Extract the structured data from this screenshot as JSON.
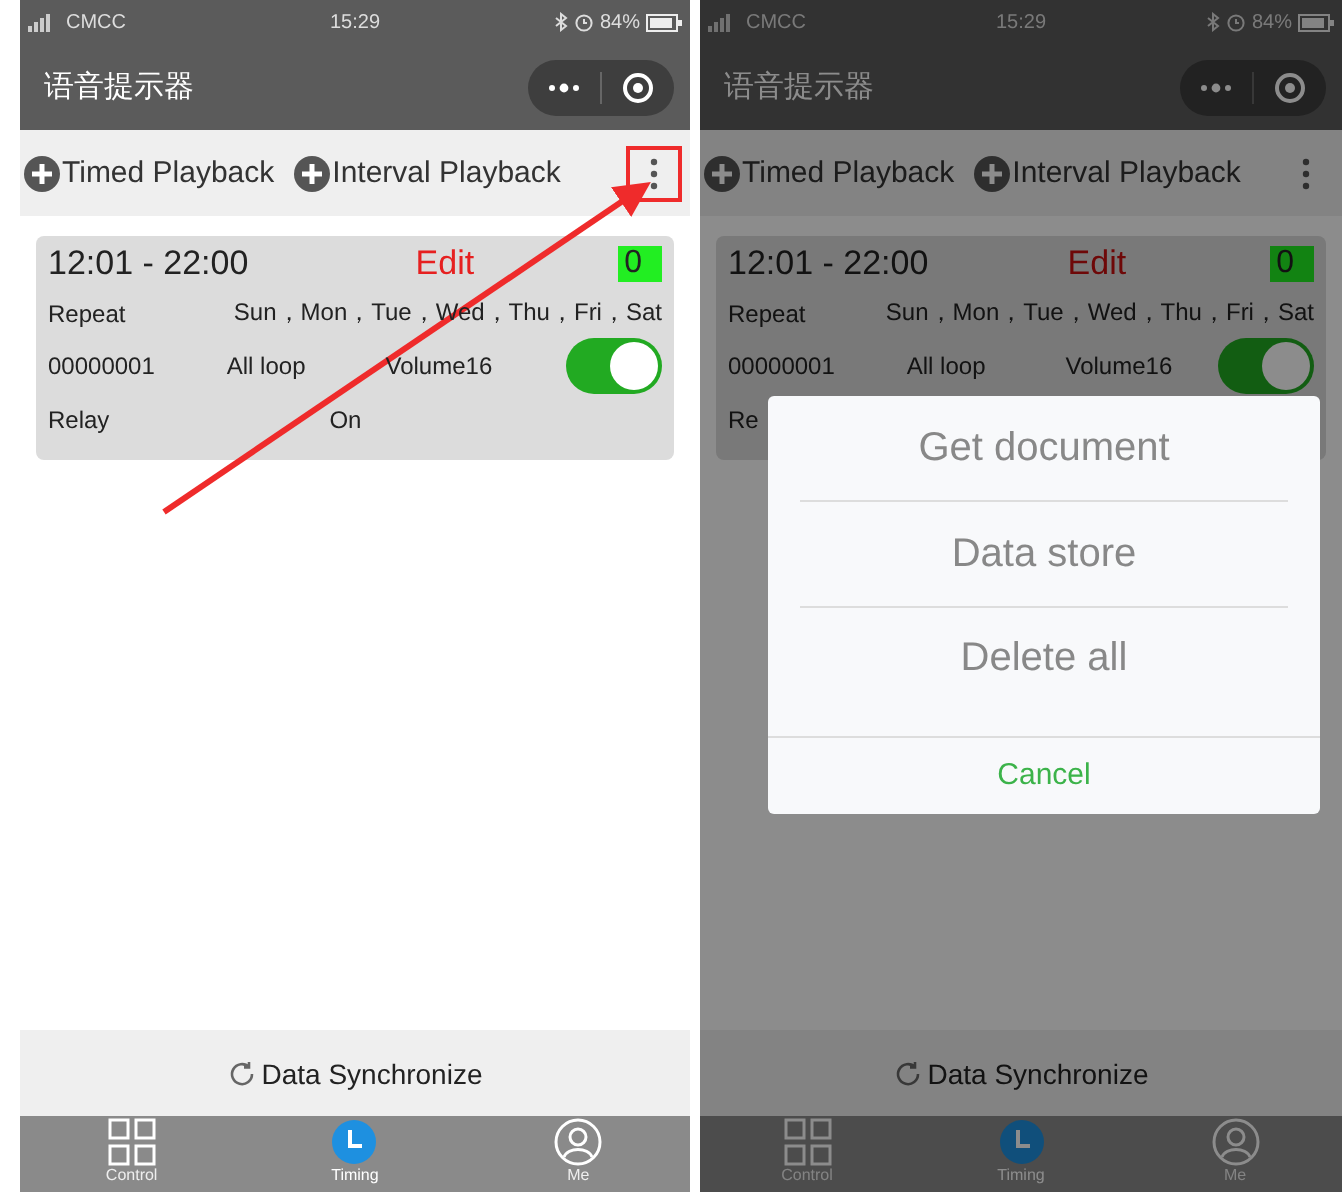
{
  "screens": [
    {
      "status_bar": {
        "carrier": "CMCC",
        "time": "15:29",
        "battery": "84%"
      },
      "title": "语音提示器",
      "toolbar": {
        "buttons": [
          {
            "label": "Timed Playback"
          },
          {
            "label": "Interval Playback"
          }
        ],
        "more_highlighted": true
      },
      "schedules": [
        {
          "time_range": "12:01 - 22:00",
          "edit": "Edit",
          "count": "0",
          "repeat_label": "Repeat",
          "days": "Sun，Mon，Tue，Wed，Thu，Fri，Sat",
          "code": "00000001",
          "mode": "All loop",
          "volume": "Volume16",
          "on": true,
          "relay_label": "Relay",
          "relay_state": "On"
        }
      ],
      "sync_button": "Data Synchronize",
      "tabs": [
        {
          "kind": "grid",
          "label": "Control",
          "selected": false
        },
        {
          "kind": "clock",
          "label": "Timing",
          "selected": true
        },
        {
          "kind": "person",
          "label": "Me",
          "selected": false
        }
      ]
    },
    {
      "status_bar": {
        "carrier": "CMCC",
        "time": "15:29",
        "battery": "84%"
      },
      "title": "语音提示器",
      "toolbar": {
        "buttons": [
          {
            "label": "Timed Playback"
          },
          {
            "label": "Interval Playback"
          }
        ],
        "more_highlighted": false
      },
      "schedules": [
        {
          "time_range": "12:01 - 22:00",
          "edit": "Edit",
          "count": "0",
          "repeat_label": "Repeat",
          "days": "Sun，Mon，Tue，Wed，Thu，Fri，Sat",
          "code": "00000001",
          "mode": "All loop",
          "volume": "Volume16",
          "on": true,
          "relay_label": "Re"
        }
      ],
      "sync_button": "Data Synchronize",
      "tabs": [
        {
          "kind": "grid",
          "label": "Control",
          "selected": false
        },
        {
          "kind": "clock",
          "label": "Timing",
          "selected": true
        },
        {
          "kind": "person",
          "label": "Me",
          "selected": false
        }
      ],
      "action_sheet": {
        "items": [
          "Get document",
          "Data store",
          "Delete all"
        ],
        "cancel": "Cancel"
      }
    }
  ]
}
